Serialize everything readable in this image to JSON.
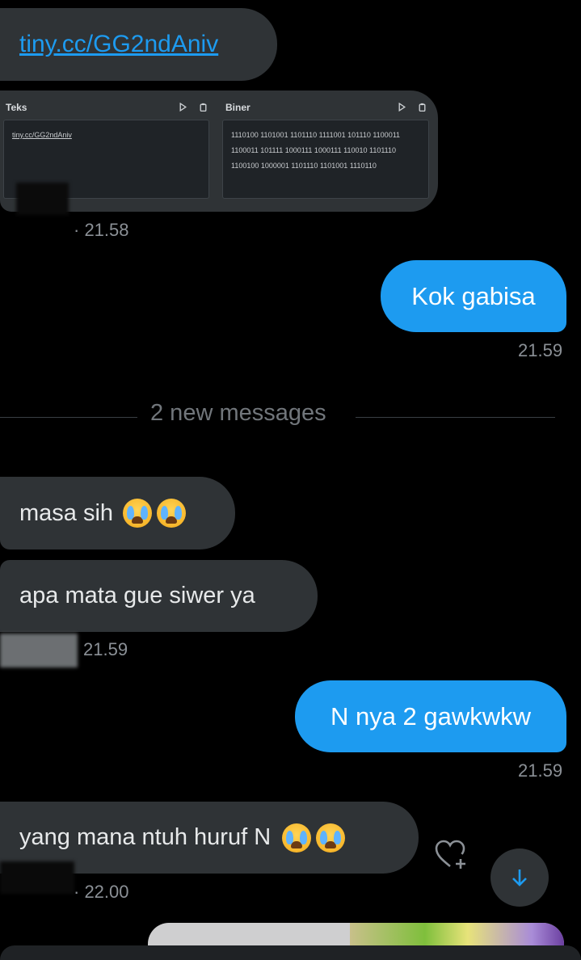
{
  "messages": {
    "link_bubble": {
      "text": "tiny.cc/GG2ndAniv"
    },
    "translator": {
      "left_title": "Teks",
      "right_title": "Biner",
      "left_text": "tiny.cc/GG2ndAniv",
      "right_text": "1110100 1101001 1101110 1111001 101110 1100011 1100011 101111 1000111 1000111 110010 1101110 1100100 1000001 1101110 1101001 1110110"
    },
    "time_1": "· 21.58",
    "out_1": {
      "text": "Kok gabisa",
      "time": "21.59"
    },
    "divider": "2 new messages",
    "in_2": {
      "text": "masa sih"
    },
    "in_3": {
      "text": "apa mata gue siwer ya"
    },
    "time_2": "21.59",
    "out_2": {
      "text": "N nya 2 gawkwkw",
      "time": "21.59"
    },
    "in_4": {
      "text": "yang mana ntuh huruf N"
    },
    "time_3": "· 22.00"
  },
  "icons": [
    "play-icon",
    "copy-icon",
    "heart-plus-icon",
    "arrow-down-icon",
    "loudly-crying-face-emoji"
  ],
  "colors": {
    "accent": "#1d9bf0",
    "incoming_bubble": "#2f3336",
    "background": "#000000"
  }
}
